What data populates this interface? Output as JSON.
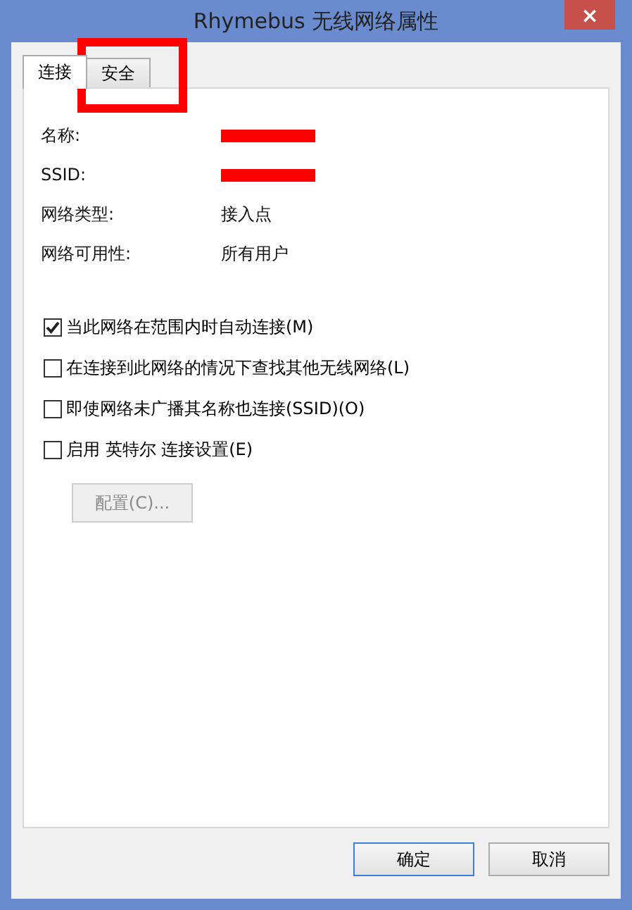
{
  "window": {
    "title": "Rhymebus 无线网络属性",
    "close": "×"
  },
  "tabs": [
    {
      "label": "连接",
      "selected": true
    },
    {
      "label": "安全",
      "selected": false
    }
  ],
  "properties": [
    {
      "label": "名称:",
      "redacted": true
    },
    {
      "label": "SSID:",
      "redacted": true
    },
    {
      "label": "网络类型:",
      "value": "接入点"
    },
    {
      "label": "网络可用性:",
      "value": "所有用户"
    }
  ],
  "options": [
    {
      "label": "当此网络在范围内时自动连接(M)",
      "checked": true
    },
    {
      "label": "在连接到此网络的情况下查找其他无线网络(L)",
      "checked": false
    },
    {
      "label": "即使网络未广播其名称也连接(SSID)(O)",
      "checked": false
    },
    {
      "label": "启用 英特尔 连接设置(E)",
      "checked": false
    }
  ],
  "configure_button": {
    "label": "配置(C)...",
    "disabled": true
  },
  "buttons": [
    {
      "label": "确定",
      "default": true
    },
    {
      "label": "取消",
      "default": false
    }
  ]
}
